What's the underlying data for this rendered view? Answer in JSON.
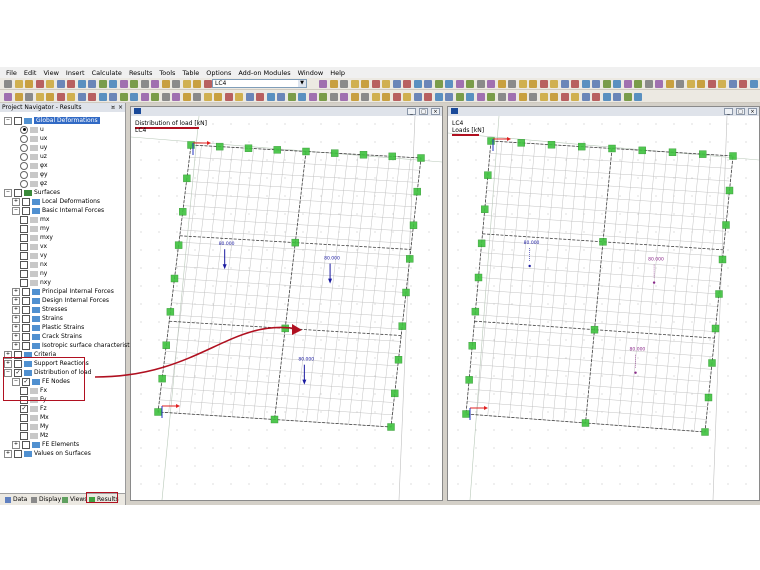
{
  "menu": [
    "File",
    "Edit",
    "View",
    "Insert",
    "Calculate",
    "Results",
    "Tools",
    "Table",
    "Options",
    "Add-on Modules",
    "Window",
    "Help"
  ],
  "toolbar": {
    "load_case": "LC4"
  },
  "navigator": {
    "title": "Project Navigator - Results",
    "items": [
      {
        "label": "Global Deformations",
        "level": 0,
        "selected": true
      },
      {
        "label": "u",
        "level": 2,
        "radio_on": true
      },
      {
        "label": "ux",
        "level": 2
      },
      {
        "label": "uy",
        "level": 2
      },
      {
        "label": "uz",
        "level": 2
      },
      {
        "label": "φx",
        "level": 2
      },
      {
        "label": "φy",
        "level": 2
      },
      {
        "label": "φz",
        "level": 2
      },
      {
        "label": "Surfaces",
        "level": 0
      },
      {
        "label": "Local Deformations",
        "level": 1
      },
      {
        "label": "Basic Internal Forces",
        "level": 1
      },
      {
        "label": "mx",
        "level": 2
      },
      {
        "label": "my",
        "level": 2
      },
      {
        "label": "mxy",
        "level": 2
      },
      {
        "label": "vx",
        "level": 2
      },
      {
        "label": "vy",
        "level": 2
      },
      {
        "label": "nx",
        "level": 2
      },
      {
        "label": "ny",
        "level": 2
      },
      {
        "label": "nxy",
        "level": 2
      },
      {
        "label": "Principal Internal Forces",
        "level": 1
      },
      {
        "label": "Design Internal Forces",
        "level": 1
      },
      {
        "label": "Stresses",
        "level": 1
      },
      {
        "label": "Strains",
        "level": 1
      },
      {
        "label": "Plastic Strains",
        "level": 1
      },
      {
        "label": "Crack Strains",
        "level": 1
      },
      {
        "label": "Isotropic surface characteristics",
        "level": 1
      },
      {
        "label": "Criteria",
        "level": 0
      },
      {
        "label": "Support Reactions",
        "level": 0
      },
      {
        "label": "Distribution of load",
        "level": 0
      },
      {
        "label": "FE Nodes",
        "level": 1
      },
      {
        "label": "Fx",
        "level": 2
      },
      {
        "label": "Fy",
        "level": 2
      },
      {
        "label": "Fz",
        "level": 2
      },
      {
        "label": "Mx",
        "level": 2
      },
      {
        "label": "My",
        "level": 2
      },
      {
        "label": "Mz",
        "level": 2
      },
      {
        "label": "FE Elements",
        "level": 1
      },
      {
        "label": "Values on Surfaces",
        "level": 0
      }
    ],
    "tabs": [
      "Data",
      "Display",
      "Views",
      "Results"
    ]
  },
  "left_window": {
    "line1": "Distribution of load [kN]",
    "line2": "LC4",
    "values": [
      "80.000",
      "80.000",
      "80.000"
    ]
  },
  "right_window": {
    "line1": "LC4",
    "line2": "Loads [kN]",
    "values": [
      "80.000",
      "80.000",
      "80.000"
    ]
  },
  "colors": {
    "accent": "#b01020",
    "support": "#3ec13e",
    "load_arrow": "#1a1aa0",
    "load_label": "#9a2a9a"
  }
}
